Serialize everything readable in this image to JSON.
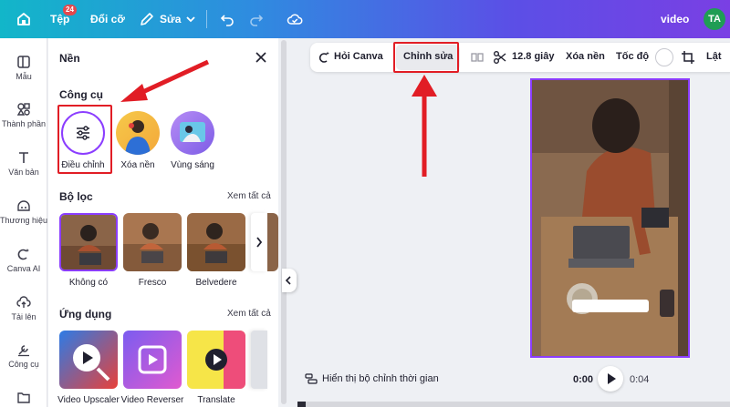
{
  "topbar": {
    "file_label": "Tệp",
    "file_badge": "24",
    "resize_label": "Đổi cỡ",
    "edit_label": "Sửa",
    "project_name": "video",
    "avatar_initials": "TA"
  },
  "rail": {
    "items": [
      {
        "label": "Mẫu",
        "icon": "template-icon"
      },
      {
        "label": "Thành phần",
        "icon": "elements-icon"
      },
      {
        "label": "Văn bản",
        "icon": "text-icon"
      },
      {
        "label": "Thương hiệu",
        "icon": "brand-icon"
      },
      {
        "label": "Canva AI",
        "icon": "canva-ai-icon"
      },
      {
        "label": "Tải lên",
        "icon": "upload-icon"
      },
      {
        "label": "Công cụ",
        "icon": "tools-icon"
      }
    ]
  },
  "panel": {
    "title": "Nền",
    "tools_title": "Công cụ",
    "tools": [
      {
        "label": "Điều chỉnh"
      },
      {
        "label": "Xóa nền"
      },
      {
        "label": "Vùng sáng"
      }
    ],
    "filters_title": "Bộ lọc",
    "filters_see_all": "Xem tất cả",
    "filters": [
      {
        "label": "Không có"
      },
      {
        "label": "Fresco"
      },
      {
        "label": "Belvedere"
      }
    ],
    "apps_title": "Ứng dụng",
    "apps_see_all": "Xem tất cả",
    "apps": [
      {
        "label": "Video Upscaler"
      },
      {
        "label": "Video Reverser"
      },
      {
        "label": "Translate"
      }
    ]
  },
  "context_toolbar": {
    "ask_canva": "Hỏi Canva",
    "edit": "Chỉnh sửa",
    "duration": "12.8 giây",
    "remove_bg": "Xóa nền",
    "speed": "Tốc độ",
    "flip": "Lật"
  },
  "playback": {
    "timeline_toggle": "Hiển thị bộ chỉnh thời gian",
    "current_time": "0:00",
    "total_time": "0:04",
    "progress_fraction": 0.02
  },
  "colors": {
    "accent": "#8b3dff",
    "annotation_red": "#e11d25"
  }
}
